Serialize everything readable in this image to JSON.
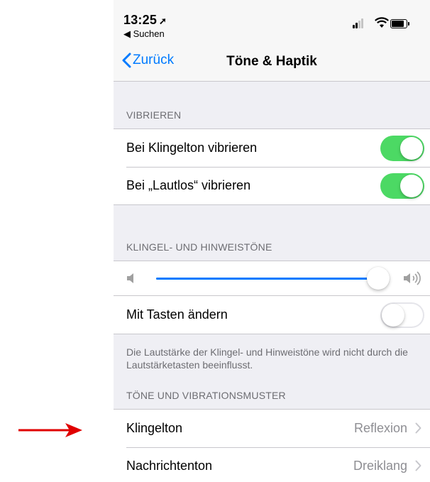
{
  "statusbar": {
    "time": "13:25",
    "back_app": "◀ Suchen"
  },
  "navbar": {
    "back_label": "Zurück",
    "title": "Töne & Haptik"
  },
  "vibrate_section": {
    "header": "VIBRIEREN",
    "rows": [
      {
        "label": "Bei Klingelton vibrieren",
        "on": true
      },
      {
        "label": "Bei „Lautlos“ vibrieren",
        "on": true
      }
    ]
  },
  "ringer_section": {
    "header": "KLINGEL- UND HINWEISTÖNE",
    "volume_level": 0.96,
    "change_with_buttons": {
      "label": "Mit Tasten ändern",
      "on": false
    },
    "footer": "Die Lautstärke der Klingel- und Hinweistöne wird nicht durch die Lautstärketasten beeinflusst."
  },
  "sounds_section": {
    "header": "TÖNE UND VIBRATIONSMUSTER",
    "rows": [
      {
        "label": "Klingelton",
        "value": "Reflexion"
      },
      {
        "label": "Nachrichtenton",
        "value": "Dreiklang"
      }
    ]
  },
  "colors": {
    "accent": "#007aff",
    "toggle_on": "#4cd964",
    "annotation_arrow": "#e00000"
  }
}
